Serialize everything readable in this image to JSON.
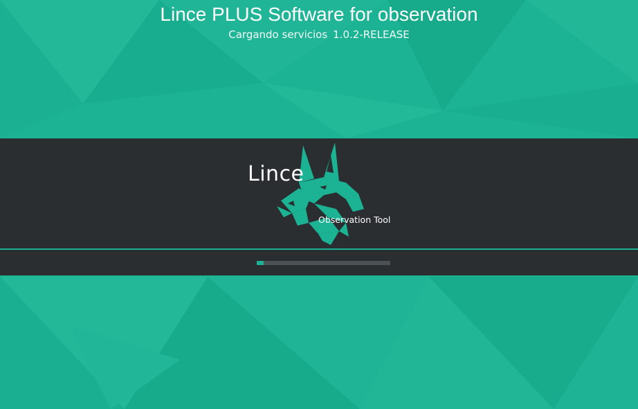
{
  "header": {
    "title": "Lince PLUS Software for observation",
    "status_text": "Cargando servicios",
    "version": "1.0.2-RELEASE"
  },
  "splash": {
    "brand": "Lince",
    "tagline": "Observation Tool",
    "logo_icon": "lynx-head-icon"
  },
  "progress": {
    "fraction": 0.05
  },
  "colors": {
    "background": "#1bb394",
    "band": "#2a2e31",
    "accent": "#1bb394",
    "progress_track": "#4b5155",
    "text": "#ffffff"
  }
}
